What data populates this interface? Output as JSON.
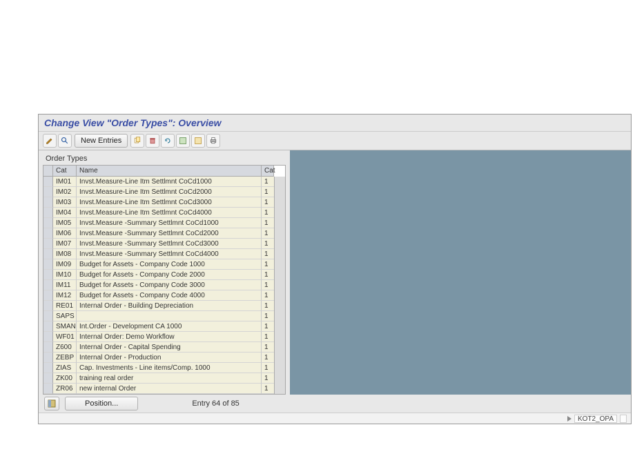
{
  "title": "Change View \"Order Types\": Overview",
  "toolbar": {
    "new_entries": "New Entries"
  },
  "panel_title": "Order Types",
  "columns": {
    "c1": "Cat",
    "c2": "Name",
    "c3": "Cat"
  },
  "rows": [
    {
      "cat": "IM01",
      "name": "Invst.Measure-Line Itm Settlmnt CoCd1000",
      "c3": "1"
    },
    {
      "cat": "IM02",
      "name": "Invst.Measure-Line Itm Settlmnt CoCd2000",
      "c3": "1"
    },
    {
      "cat": "IM03",
      "name": "Invst.Measure-Line Itm Settlmnt CoCd3000",
      "c3": "1"
    },
    {
      "cat": "IM04",
      "name": "Invst.Measure-Line Itm Settlmnt CoCd4000",
      "c3": "1"
    },
    {
      "cat": "IM05",
      "name": "Invst.Measure -Summary Settlmnt CoCd1000",
      "c3": "1"
    },
    {
      "cat": "IM06",
      "name": "Invst.Measure -Summary Settlmnt CoCd2000",
      "c3": "1"
    },
    {
      "cat": "IM07",
      "name": "Invst.Measure -Summary Settlmnt CoCd3000",
      "c3": "1"
    },
    {
      "cat": "IM08",
      "name": "Invst.Measure -Summary Settlmnt CoCd4000",
      "c3": "1"
    },
    {
      "cat": "IM09",
      "name": "Budget for Assets - Company Code 1000",
      "c3": "1"
    },
    {
      "cat": "IM10",
      "name": "Budget for Assets - Company Code 2000",
      "c3": "1"
    },
    {
      "cat": "IM11",
      "name": "Budget for Assets - Company Code 3000",
      "c3": "1"
    },
    {
      "cat": "IM12",
      "name": "Budget for Assets - Company Code 4000",
      "c3": "1"
    },
    {
      "cat": "RE01",
      "name": "Internal Order - Building Depreciation",
      "c3": "1"
    },
    {
      "cat": "SAPS",
      "name": "",
      "c3": "1"
    },
    {
      "cat": "SMAN",
      "name": "Int.Order - Development           CA 1000",
      "c3": "1"
    },
    {
      "cat": "WF01",
      "name": "Internal Order: Demo Workflow",
      "c3": "1"
    },
    {
      "cat": "Z600",
      "name": "Internal Order - Capital Spending",
      "c3": "1"
    },
    {
      "cat": "ZEBP",
      "name": "Internal Order - Production",
      "c3": "1"
    },
    {
      "cat": "ZIAS",
      "name": "Cap. Investments - Line items/Comp. 1000",
      "c3": "1"
    },
    {
      "cat": "ZK00",
      "name": "training real order",
      "c3": "1"
    },
    {
      "cat": "ZR06",
      "name": "new internal Order",
      "c3": "1"
    }
  ],
  "footer": {
    "position": "Position...",
    "entry_count": "Entry 64 of 85"
  },
  "status": {
    "tcode": "KOT2_OPA"
  }
}
